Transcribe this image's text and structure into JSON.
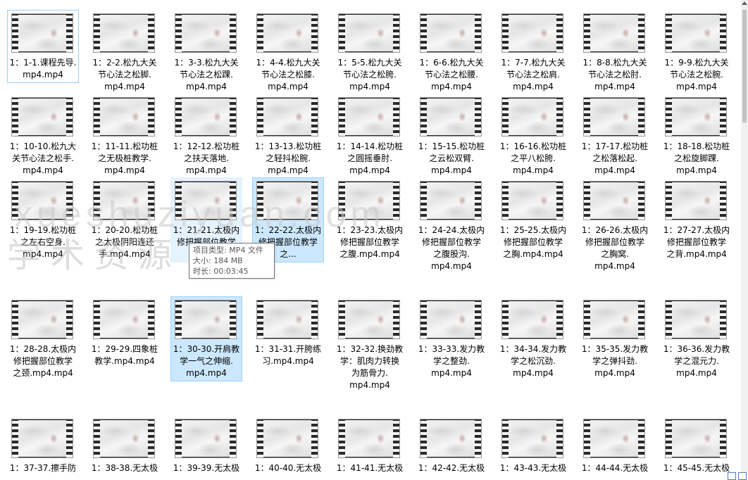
{
  "files": [
    {
      "label": "1：1-1.课程先导.\nmp4.mp4",
      "state": "focused"
    },
    {
      "label": "1：2-2.松九大关\n节心法之松脚.\nmp4.mp4"
    },
    {
      "label": "1：3-3.松九大关\n节心法之松踝.\nmp4.mp4"
    },
    {
      "label": "1：4-4.松九大关\n节心法之松膝.\nmp4.mp4"
    },
    {
      "label": "1：5-5.松九大关\n节心法之松胯.\nmp4.mp4"
    },
    {
      "label": "1：6-6.松九大关\n节心法之松腰.\nmp4.mp4"
    },
    {
      "label": "1：7-7.松九大关\n节心法之松肩.\nmp4.mp4"
    },
    {
      "label": "1：8-8.松九大关\n节心法之松肘.\nmp4.mp4"
    },
    {
      "label": "1：9-9.松九大关\n节心法之松腕.\nmp4.mp4"
    },
    {
      "label": "1：10-10.松九大\n关节心法之松手.\nmp4.mp4"
    },
    {
      "label": "1：11-11.松功桩\n之无极桩教学.\nmp4.mp4"
    },
    {
      "label": "1：12-12.松功桩\n之扶天落地.\nmp4.mp4"
    },
    {
      "label": "1：13-13.松功桩\n之轻抖松腕.\nmp4.mp4"
    },
    {
      "label": "1：14-14.松功桩\n之圆摇垂肘.\nmp4.mp4"
    },
    {
      "label": "1：15-15.松功桩\n之云松双臂.\nmp4.mp4"
    },
    {
      "label": "1：16-16.松功桩\n之平八松胯.\nmp4.mp4"
    },
    {
      "label": "1：17-17.松功桩\n之松落松起.\nmp4.mp4"
    },
    {
      "label": "1：18-18.松功桩\n之松旋脚踝.\nmp4.mp4"
    },
    {
      "label": "1：19-19.松功桩\n之左右空身.\nmp4.mp4"
    },
    {
      "label": "1：20-20.松功桩\n之太极阴阳连还\n手.mp4.mp4"
    },
    {
      "label": "1：21-21.太极内\n修把握部位教学\n之...",
      "state": "hovered"
    },
    {
      "label": "1：22-22.太极内\n修把握部位教学\n之...",
      "state": "selected"
    },
    {
      "label": "1：23-23.太极内\n修把握部位教学\n之腹.mp4.mp4"
    },
    {
      "label": "1：24-24.太极内\n修把握部位教学\n之腹股沟.\nmp4.mp4"
    },
    {
      "label": "1：25-25.太极内\n修把握部位教学\n之胸.mp4.mp4"
    },
    {
      "label": "1：26-26.太极内\n修把握部位教学\n之胸窝.\nmp4.mp4"
    },
    {
      "label": "1：27-27.太极内\n修把握部位教学\n之背.mp4.mp4"
    },
    {
      "label": "1：28-28.太极内\n修把握部位教学\n之颈.mp4.mp4"
    },
    {
      "label": "1：29-29.四象桩\n教学.mp4.mp4"
    },
    {
      "label": "1：30-30.开肩教\n学一气之伸缩.\nmp4.mp4",
      "state": "selected"
    },
    {
      "label": "1：31-31.开胯练\n习.mp4.mp4"
    },
    {
      "label": "1：32-32.换劲教\n学：肌肉力转换\n为筋骨力.\nmp4.mp4"
    },
    {
      "label": "1：33-33.发力教\n学之整劲.\nmp4.mp4"
    },
    {
      "label": "1：34-34.发力教\n学之松沉劲.\nmp4.mp4"
    },
    {
      "label": "1：35-35.发力教\n学之弹抖劲.\nmp4.mp4"
    },
    {
      "label": "1：36-36.发力教\n学之混元力.\nmp4.mp4"
    },
    {
      "label": "1：37-37.擦手防"
    },
    {
      "label": "1：38-38.无太极"
    },
    {
      "label": "1：39-39.无太极"
    },
    {
      "label": "1：40-40.无太极"
    },
    {
      "label": "1：41-41.无太极"
    },
    {
      "label": "1：42-42.无太极"
    },
    {
      "label": "1：43-43.无太极"
    },
    {
      "label": "1：44-44.无太极"
    },
    {
      "label": "1：45-45.无太极"
    }
  ],
  "tooltip": {
    "type": "项目类型: MP4 文件",
    "size": "大小: 184 MB",
    "duration": "时长: 00:03:45"
  },
  "watermark": {
    "line1": "xueshuziyuan.com",
    "line2": "学术资源"
  }
}
